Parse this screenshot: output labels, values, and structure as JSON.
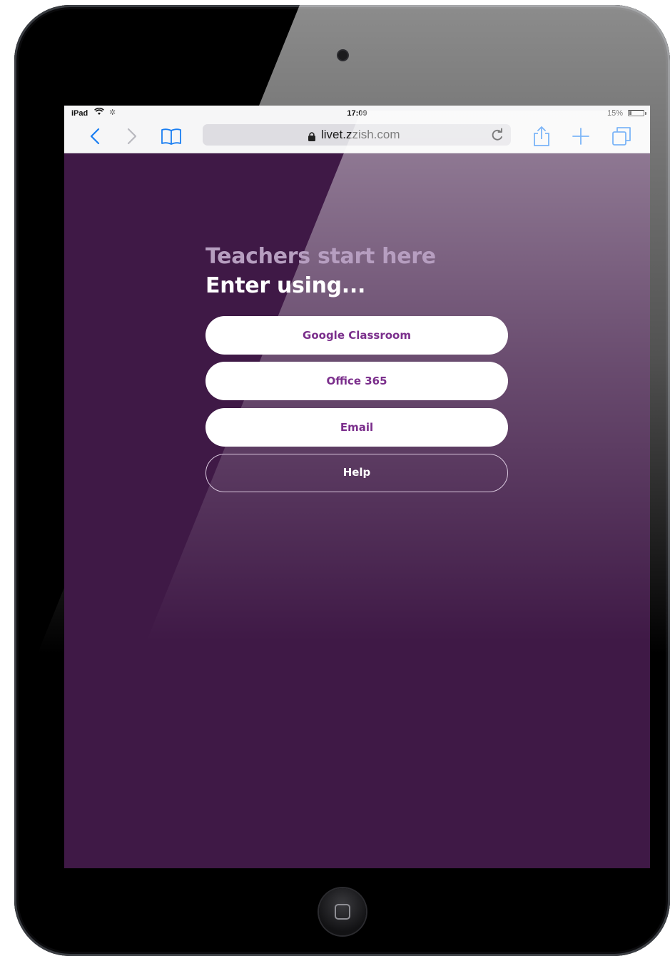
{
  "status_bar": {
    "carrier": "iPad",
    "time": "17:09",
    "battery_percent": "15%",
    "battery_level": 0.15
  },
  "browser": {
    "url": "livet.zzish.com",
    "icons": [
      "back-icon",
      "forward-icon",
      "bookmarks-icon",
      "lock-icon",
      "reload-icon",
      "share-icon",
      "add-tab-icon",
      "tabs-icon"
    ],
    "accent_color": "#1a7ef2"
  },
  "page": {
    "title": "Teachers start here",
    "subtitle": "Enter using...",
    "buttons": {
      "google": "Google Classroom",
      "office": "Office 365",
      "email": "Email",
      "help": "Help"
    },
    "background_color": "#3f1946",
    "button_text_color": "#7b2f8c"
  }
}
